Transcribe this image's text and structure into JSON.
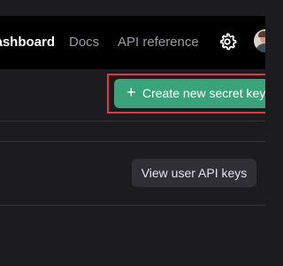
{
  "nav": {
    "dashboard_label": "Dashboard",
    "docs_label": "Docs",
    "api_reference_label": "API reference",
    "settings_icon": "gear-icon",
    "avatar_icon": "user-avatar"
  },
  "actions": {
    "create_key_icon": "+",
    "create_key_label": "Create new secret key",
    "view_user_keys_label": "View user API keys"
  },
  "colors": {
    "navbar_background": "#000000",
    "page_background": "#1c1c1f",
    "primary_button": "#3aa37c",
    "secondary_button": "#2f2f35",
    "highlight_border": "#e0384a"
  }
}
